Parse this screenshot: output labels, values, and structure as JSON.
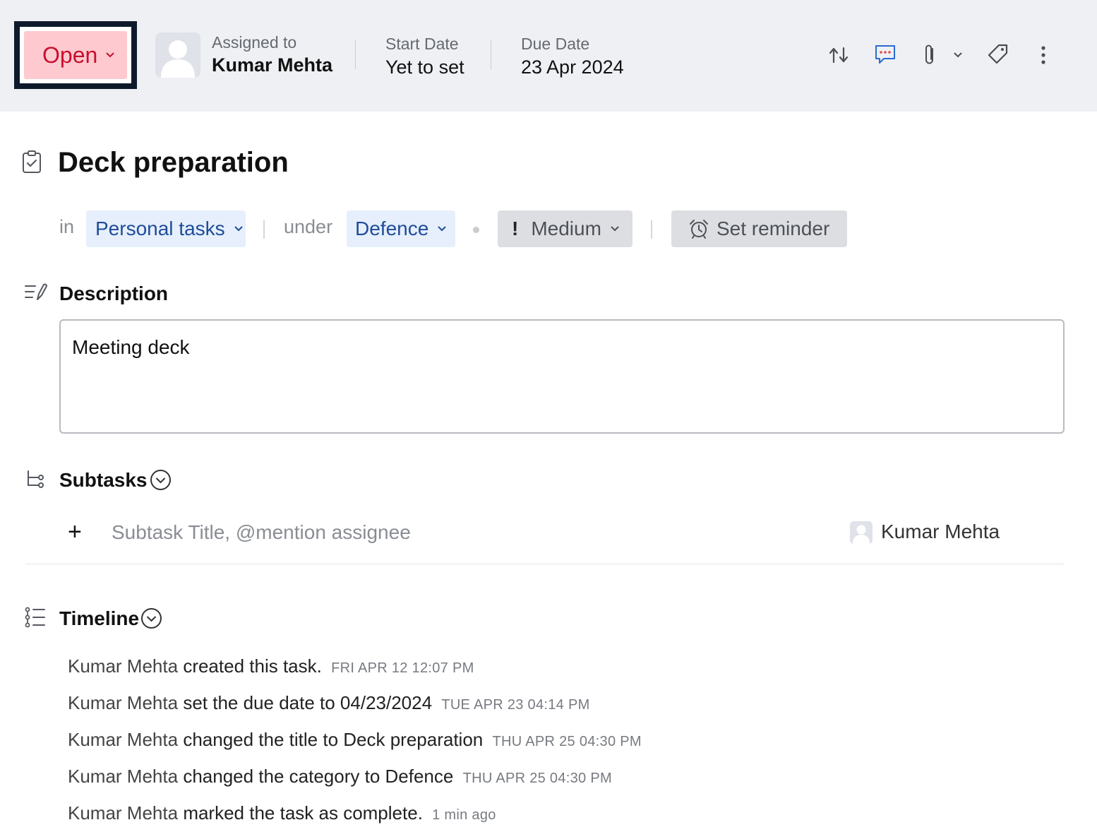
{
  "header": {
    "status": "Open",
    "assigned_label": "Assigned to",
    "assigned_name": "Kumar Mehta",
    "start_label": "Start Date",
    "start_value": "Yet to set",
    "due_label": "Due Date",
    "due_value": "23 Apr 2024",
    "icons": [
      "transfer-icon",
      "comment-icon",
      "attachment-icon",
      "chevron-down-icon",
      "tag-icon",
      "more-icon"
    ]
  },
  "task": {
    "title": "Deck preparation",
    "in_label": "in",
    "list": "Personal tasks",
    "under_label": "under",
    "category": "Defence",
    "priority_mark": "!",
    "priority": "Medium",
    "reminder": "Set reminder"
  },
  "description": {
    "title": "Description",
    "text": "Meeting deck"
  },
  "subtasks": {
    "title": "Subtasks",
    "add_symbol": "+",
    "placeholder": "Subtask Title, @mention assignee",
    "assignee": "Kumar Mehta"
  },
  "timeline": {
    "title": "Timeline",
    "entries": [
      {
        "actor": "Kumar Mehta",
        "action": "created this task.",
        "time": "FRI APR 12 12:07 PM"
      },
      {
        "actor": "Kumar Mehta",
        "action": "set the due date to 04/23/2024",
        "time": "TUE APR 23 04:14 PM"
      },
      {
        "actor": "Kumar Mehta",
        "action": "changed the title to Deck preparation",
        "time": "THU APR 25 04:30 PM"
      },
      {
        "actor": "Kumar Mehta",
        "action": "changed the category to Defence",
        "time": "THU APR 25 04:30 PM"
      },
      {
        "actor": "Kumar Mehta",
        "action": "marked the task as complete.",
        "time": "1 min ago"
      }
    ]
  },
  "colors": {
    "status_bg": "#ffc9d0",
    "status_text": "#c8102e",
    "chip_blue_bg": "#e6effb",
    "chip_blue_text": "#1f4c9a",
    "header_bg": "#eef0f4",
    "comment_icon": "#2a6bd1",
    "comment_dots": "#e04848"
  }
}
